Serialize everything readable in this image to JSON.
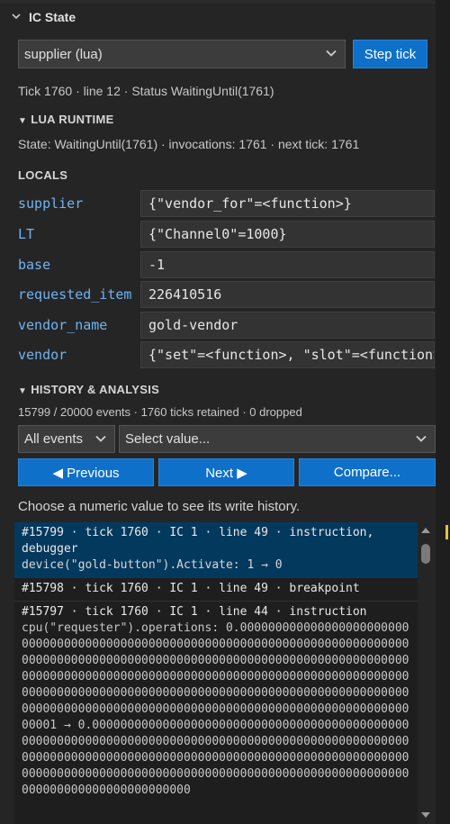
{
  "panel": {
    "title": "IC State"
  },
  "controls": {
    "script_select": "supplier (lua)",
    "step_button": "Step tick"
  },
  "status_line": "Tick 1760 · line 12 · Status WaitingUntil(1761)",
  "lua_runtime": {
    "title": "LUA RUNTIME",
    "state": "State: WaitingUntil(1761) · invocations: 1761 · next tick: 1761"
  },
  "locals": {
    "title": "LOCALS",
    "items": [
      {
        "key": "supplier",
        "value": "{\"vendor_for\"=<function>}"
      },
      {
        "key": "LT",
        "value": "{\"Channel0\"=1000}"
      },
      {
        "key": "base",
        "value": "-1"
      },
      {
        "key": "requested_item",
        "value": "226410516"
      },
      {
        "key": "vendor_name",
        "value": "gold-vendor"
      },
      {
        "key": "vendor",
        "value": "{\"set\"=<function>, \"slot\"=<function>}"
      }
    ]
  },
  "history": {
    "title": "HISTORY & ANALYSIS",
    "stats": "15799 / 20000 events · 1760 ticks retained · 0 dropped",
    "filter_select": "All events",
    "value_select": "Select value...",
    "prev_button": "◀ Previous",
    "next_button": "Next ▶",
    "compare_button": "Compare...",
    "hint": "Choose a numeric value to see its write history.",
    "entries": [
      {
        "header": "#15799 · tick 1760 · IC 1 · line 49 · instruction, debugger",
        "detail": "device(\"gold-button\").Activate: 1 → 0"
      },
      {
        "header": "#15798 · tick 1760 · IC 1 · line 49 · breakpoint",
        "detail": ""
      },
      {
        "header": "#15797 · tick 1760 · IC 1 · line 44 · instruction",
        "detail": "cpu(\"requester\").operations: 0.0000000000000000000000000000000000000000000000000000000000000000000000000000000000000000000000000000000000000000000000000000000000000000000000000000000000000000000000000000000000000000000000000000000000000000000000000000000000000000000000000000000000000000000000000000000000000000000000000000000000000001 → 0.000000000000000000000000000000000000000000000000000000000000000000000000000000000000000000000000000000000000000000000000000000000000000000000000000000000000000000000000000000000000000000000000000000000000000000000000000000000000000000"
      }
    ]
  }
}
